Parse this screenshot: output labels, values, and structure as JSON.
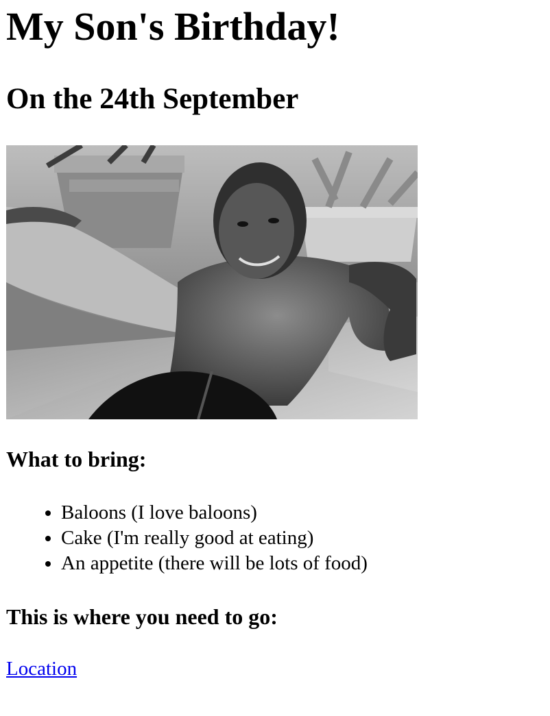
{
  "heading": "My Son's Birthday!",
  "subheading": "On the 24th September",
  "photo": {
    "alt": "Black and white photo of a smiling boy relaxing in a pool"
  },
  "bring": {
    "title": "What to bring:",
    "items": [
      "Baloons (I love baloons)",
      "Cake (I'm really good at eating)",
      "An appetite (there will be lots of food)"
    ]
  },
  "directions": {
    "title": "This is where you need to go:",
    "link_label": "Location"
  }
}
